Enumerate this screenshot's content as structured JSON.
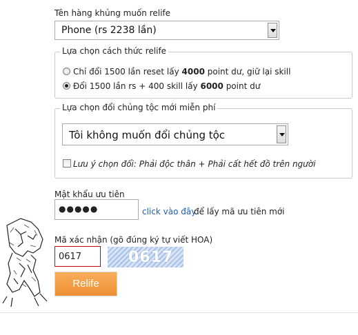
{
  "item_section": {
    "label": "Tên hàng khủng muốn relife",
    "selected": "Phone (rs 2238 lần)"
  },
  "method_section": {
    "legend": "Lựa chọn cách thức relife",
    "options": [
      {
        "pre": "Chỉ đổi 1500 lần reset lấy ",
        "bold": "4000",
        "post": " point dư, giữ lại skill",
        "selected": false
      },
      {
        "pre": "Đổi 1500 lần rs + 400 skill lấy ",
        "bold": "6000",
        "post": " point dư",
        "selected": true
      }
    ]
  },
  "race_section": {
    "legend": "Lựa chọn đổi chủng tộc mới miễn phí",
    "selected": "Tôi không muốn đổi chủng tộc",
    "note": "Lưu ý chọn đổi: Phải độc thân + Phải cất hết đồ trên người",
    "note_checked": false
  },
  "password_section": {
    "label": "Mật khẩu ưu tiên",
    "value": "●●●●●",
    "link": "click vào đây",
    "link_suffix": " để lấy mã ưu tiên mới"
  },
  "captcha_section": {
    "label": "Mã xác nhận (gõ đúng ký tự viết HOA)",
    "value": "0617",
    "image_text": "0617"
  },
  "submit_label": "Relife",
  "colors": {
    "button": "#f19a3e",
    "link": "#1a5fb4",
    "captcha_border": "#cc0000",
    "captcha_image": "#a8c1e8"
  }
}
